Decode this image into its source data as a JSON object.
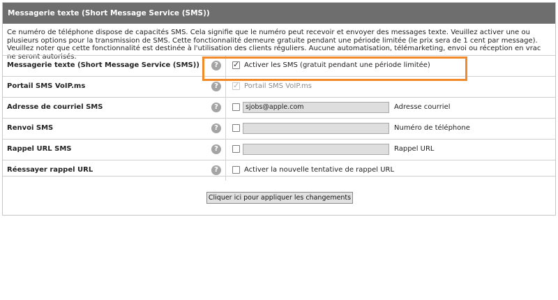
{
  "panel": {
    "title": "Messagerie texte (Short Message Service (SMS))",
    "description": "Ce numéro de téléphone dispose de capacités SMS. Cela signifie que le numéro peut recevoir et envoyer des messages texte. Veuillez activer une ou plusieurs options pour la transmission de SMS. Cette fonctionnalité demeure gratuite pendant une période limitée (le prix sera de 1 cent par message). Veuillez noter que cette fonctionnalité est destinée à l'utilisation des clients réguliers. Aucune automatisation, télémarketing, envoi ou réception en vrac ne seront autorisés."
  },
  "help_glyph": "?",
  "rows": [
    {
      "label": "Messagerie texte (Short Message Service (SMS))",
      "checked": true,
      "option_text": "Activer les SMS (gratuit pendant une période limitée)"
    },
    {
      "label": "Portail SMS VoIP.ms",
      "checked": true,
      "disabled": true,
      "option_text": "Portail SMS VoIP.ms"
    },
    {
      "label": "Adresse de courriel SMS",
      "checked": false,
      "input_value": "sjobs@apple.com",
      "input_caption": "Adresse courriel"
    },
    {
      "label": "Renvoi SMS",
      "checked": false,
      "input_value": "",
      "input_caption": "Numéro de téléphone"
    },
    {
      "label": "Rappel URL SMS",
      "checked": false,
      "input_value": "",
      "input_caption": "Rappel URL"
    },
    {
      "label": "Réessayer rappel URL",
      "checked": false,
      "option_text": "Activer la nouvelle tentative de rappel URL"
    }
  ],
  "apply_button": "Cliquer ici pour appliquer les changements",
  "colors": {
    "header_bg": "#6e6e6e",
    "highlight": "#f08a2a",
    "field_bg": "#dedede"
  }
}
